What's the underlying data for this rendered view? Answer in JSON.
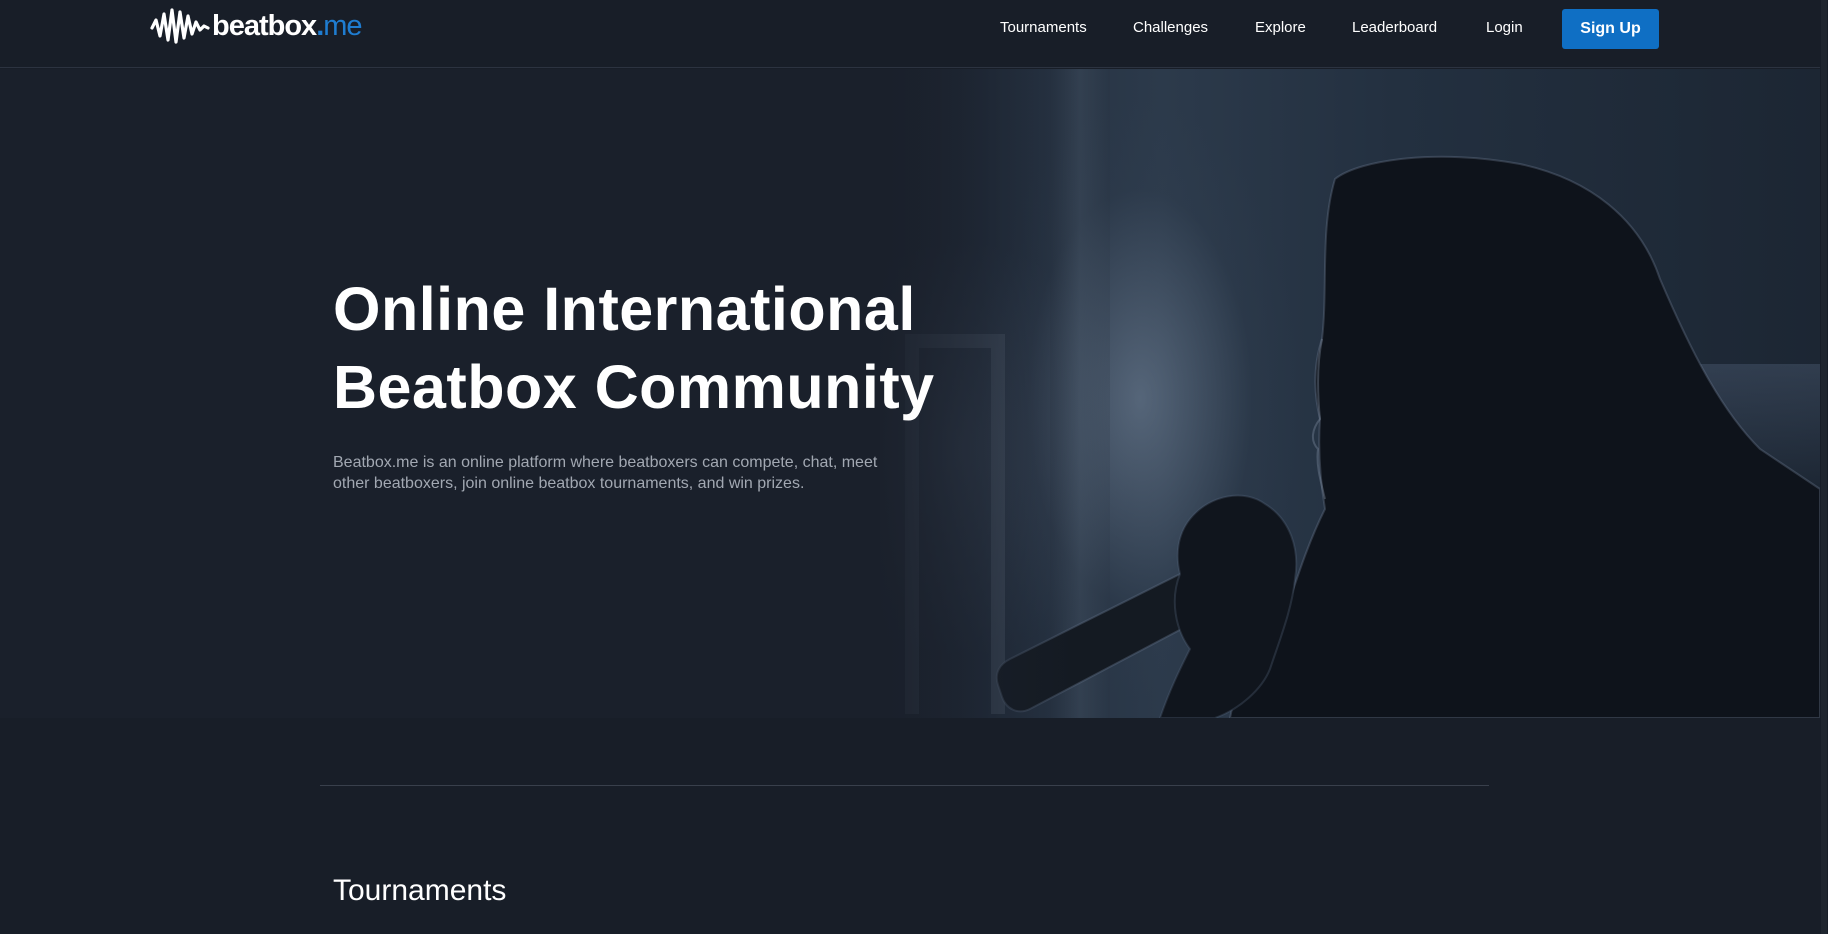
{
  "header": {
    "logo": {
      "text": "beatbox",
      "dot": ".",
      "suffix": "me"
    },
    "nav": [
      {
        "label": "Tournaments"
      },
      {
        "label": "Challenges"
      },
      {
        "label": "Explore"
      },
      {
        "label": "Leaderboard"
      },
      {
        "label": "Login"
      }
    ],
    "signup_label": "Sign Up"
  },
  "hero": {
    "title_line1": "Online International",
    "title_line2": "Beatbox Community",
    "description_line1": "Beatbox.me is an online platform where beatboxers can compete, chat, meet",
    "description_line2": "other beatboxers, join online beatbox tournaments, and win prizes."
  },
  "sections": {
    "tournaments_title": "Tournaments"
  },
  "colors": {
    "background": "#181e28",
    "accent": "#0f6fc4",
    "logo_accent": "#1f7dd1",
    "muted_text": "#a2a8b2"
  }
}
